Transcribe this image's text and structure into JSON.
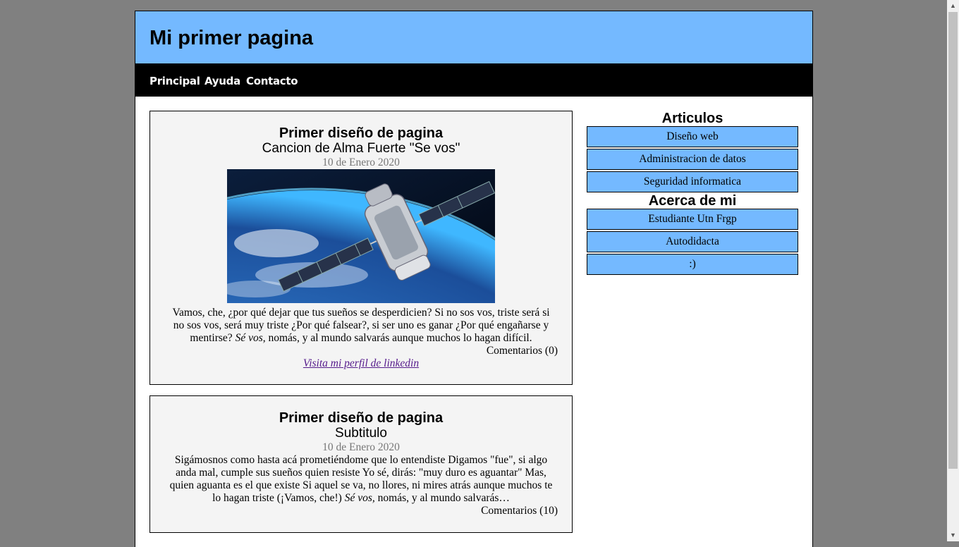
{
  "header": {
    "title": "Mi primer pagina"
  },
  "nav": {
    "items": [
      {
        "label": "Principal"
      },
      {
        "label": "Ayuda"
      },
      {
        "label": "Contacto"
      }
    ]
  },
  "articles": [
    {
      "title": "Primer diseño de pagina",
      "subtitle": "Cancion de Alma Fuerte \"Se vos\"",
      "date": "10 de Enero 2020",
      "body_before": "Vamos, che, ¿por qué dejar que tus sueños se desperdicien? Si no sos vos, triste será si no sos vos, será muy triste ¿Por qué falsear?, si ser uno es ganar ¿Por qué engañarse y mentirse? ",
      "body_em": "Sé vos",
      "body_after": ", nomás, y al mundo salvarás aunque muchos lo hagan difícil.",
      "comments": "Comentarios (0)",
      "link": "Visita mi perfil de linkedin"
    },
    {
      "title": "Primer diseño de pagina",
      "subtitle": "Subtitulo",
      "date": "10 de Enero 2020",
      "body_before": "Sigámosnos como hasta acá prometiéndome que lo entendiste Digamos \"fue\", si algo anda mal, cumple sus sueños quien resiste Yo sé, dirás: \"muy duro es aguantar\" Mas, quien aguanta es el que existe Si aquel se va, no llores, ni mires atrás aunque muchos te lo hagan triste (¡Vamos, che!) ",
      "body_em": "Sé vos,",
      "body_after": " nomás, y al mundo salvarás…",
      "comments": "Comentarios (10)"
    }
  ],
  "sidebar": {
    "articulos_heading": "Articulos",
    "articulos": [
      {
        "label": "Diseño web"
      },
      {
        "label": "Administracion de datos"
      },
      {
        "label": "Seguridad informatica"
      }
    ],
    "acerca_heading": "Acerca de mi",
    "acerca": [
      {
        "label": "Estudiante Utn Frgp"
      },
      {
        "label": "Autodidacta"
      },
      {
        "label": ":)"
      }
    ]
  },
  "colors": {
    "background": "#808080",
    "accent": "#74b9ff",
    "nav": "#000000",
    "article_bg": "#f4f4f4"
  },
  "icons": {
    "scroll_up": "scroll-up-arrow-icon",
    "scroll_down": "scroll-down-arrow-icon"
  }
}
